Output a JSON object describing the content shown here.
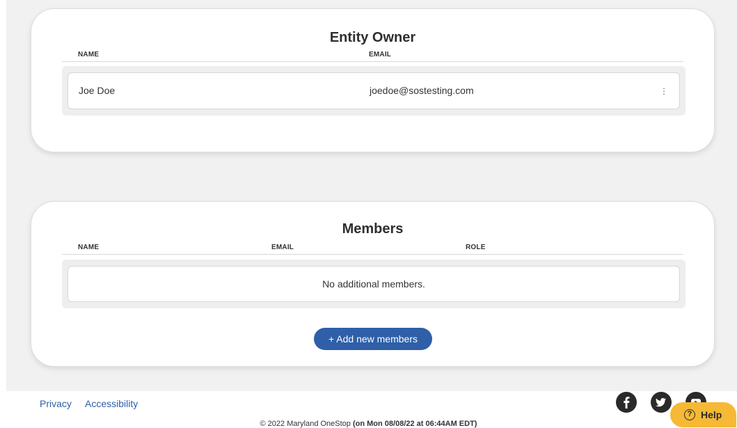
{
  "owner_card": {
    "title": "Entity Owner",
    "headers": {
      "name": "NAME",
      "email": "EMAIL"
    },
    "row": {
      "name": "Joe Doe",
      "email": "joedoe@sostesting.com",
      "menu_icon": "kebab-menu-icon"
    }
  },
  "members_card": {
    "title": "Members",
    "headers": {
      "name": "NAME",
      "email": "EMAIL",
      "role": "ROLE"
    },
    "empty_text": "No additional members.",
    "add_button_label": "+ Add new members"
  },
  "footer": {
    "links": [
      "Privacy",
      "Accessibility"
    ],
    "social_icons": [
      "facebook-icon",
      "twitter-icon",
      "youtube-icon"
    ],
    "copyright_prefix": "© 2022 Maryland OneStop",
    "copyright_time": "(on Mon 08/08/22 at 06:44AM EDT)"
  },
  "help": {
    "label": "Help",
    "icon": "question-circle-icon"
  },
  "colors": {
    "primary": "#2e5fa8",
    "help_bg": "#f6b935",
    "page_bg": "#f1f1f1"
  }
}
